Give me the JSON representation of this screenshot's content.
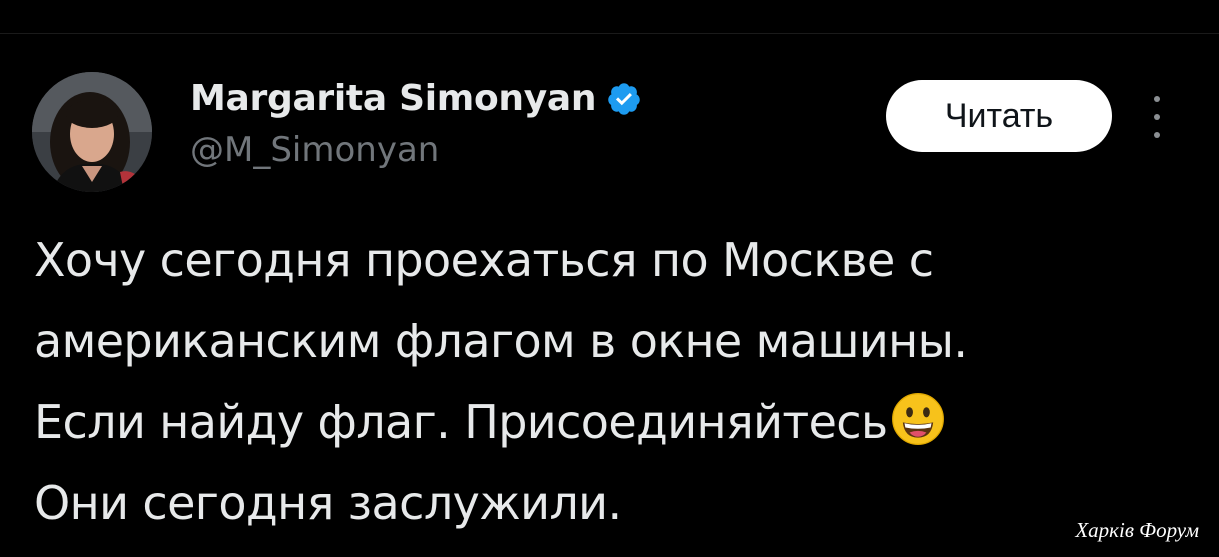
{
  "author": {
    "name": "Margarita Simonyan",
    "handle": "@M_Simonyan",
    "verified_icon": "verified-badge-icon",
    "verified_color": "#1d9bf0"
  },
  "follow_button": {
    "label": "Читать"
  },
  "more_menu": {
    "icon": "more-vertical-icon"
  },
  "tweet": {
    "lines": [
      "Хочу сегодня проехаться по Москве с",
      "американским флагом в окне машины.",
      "Если найду флаг. Присоединяйтесь",
      "Они сегодня заслужили."
    ],
    "emoji": "grinning-face-emoji"
  },
  "watermark": "Харків Форум",
  "colors": {
    "background": "#000000",
    "text": "#e7e9ea",
    "secondary": "#71767b",
    "button_bg": "#ffffff"
  }
}
